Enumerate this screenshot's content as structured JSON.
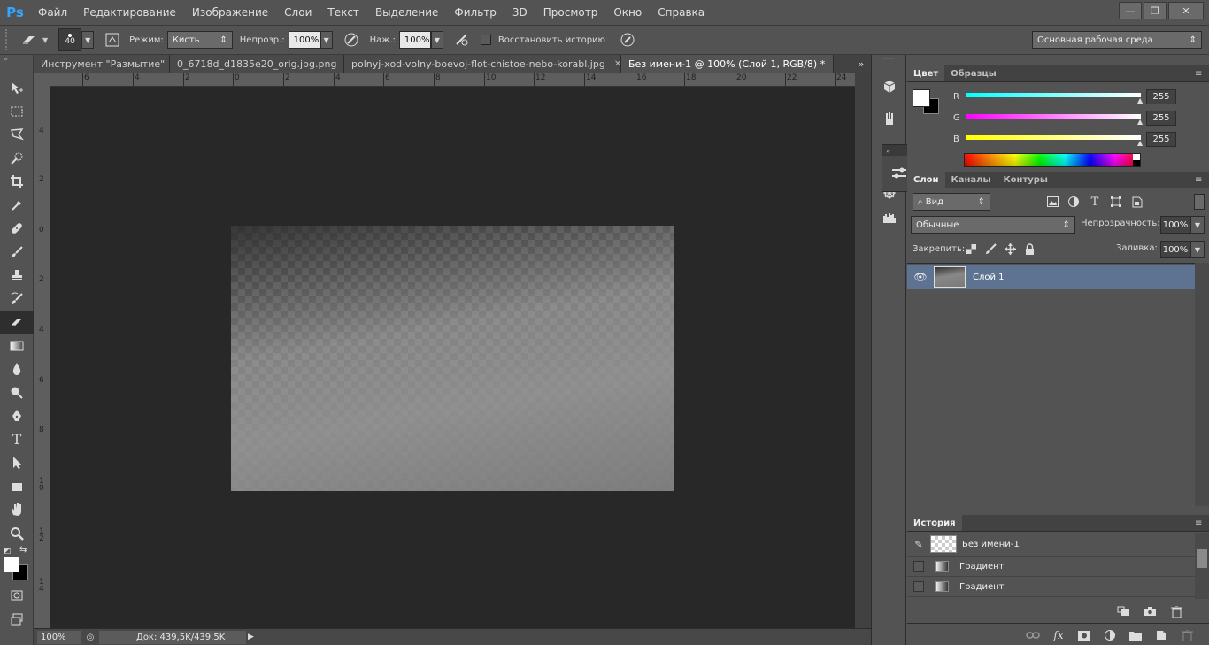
{
  "app": {
    "logo": "Ps"
  },
  "menu": [
    "Файл",
    "Редактирование",
    "Изображение",
    "Слои",
    "Текст",
    "Выделение",
    "Фильтр",
    "3D",
    "Просмотр",
    "Окно",
    "Справка"
  ],
  "window_controls": {
    "minimize": "—",
    "restore": "❐",
    "close": "✕"
  },
  "options": {
    "brush_size": "40",
    "mode_label": "Режим:",
    "mode_value": "Кисть",
    "opacity_label": "Непрозр.:",
    "opacity_value": "100%",
    "flow_label": "Наж.:",
    "flow_value": "100%",
    "restore_history_label": "Восстановить историю",
    "workspace_value": "Основная рабочая среда"
  },
  "tabs": [
    {
      "label": "Инструмент \"Размытие\"",
      "active": false
    },
    {
      "label": "0_6718d_d1835e20_orig.jpg.png",
      "active": false
    },
    {
      "label": "polnyj-xod-volny-boevoj-flot-chistoe-nebo-korabl.jpg",
      "active": false
    },
    {
      "label": "Без имени-1 @ 100% (Слой 1, RGB/8) *",
      "active": true
    }
  ],
  "tab_close": "✕",
  "tabs_more": "»",
  "rulers": {
    "h_ticks": [
      "6",
      "4",
      "2",
      "0",
      "2",
      "4",
      "6",
      "8",
      "10",
      "12",
      "14",
      "16",
      "18",
      "20",
      "22",
      "24"
    ],
    "v_ticks": [
      "4",
      "2",
      "0",
      "2",
      "4",
      "6",
      "8",
      "1\n0",
      "1\n2",
      "1\n4"
    ]
  },
  "status": {
    "zoom": "100%",
    "doc": "Док: 439,5K/439,5K"
  },
  "color_panel": {
    "tabs": [
      "Цвет",
      "Образцы"
    ],
    "channels": [
      {
        "label": "R",
        "value": "255",
        "color": "#00ffff"
      },
      {
        "label": "G",
        "value": "255",
        "color": "#ff00ff"
      },
      {
        "label": "B",
        "value": "255",
        "color": "#ffff00"
      }
    ]
  },
  "layers_panel": {
    "tabs": [
      "Слои",
      "Каналы",
      "Контуры"
    ],
    "filter_value": "Вид",
    "blend_mode": "Обычные",
    "opacity_label": "Непрозрачность:",
    "opacity_value": "100%",
    "lock_label": "Закрепить:",
    "fill_label": "Заливка:",
    "fill_value": "100%",
    "layers": [
      {
        "name": "Слой 1",
        "selected": true
      }
    ]
  },
  "history_panel": {
    "tab": "История",
    "snapshot": "Без имени-1",
    "steps": [
      "Градиент",
      "Градиент"
    ]
  },
  "colors": {
    "accent_selection": "#5d7391",
    "workspace_bg": "#282828",
    "ps_blue": "#31a8ff"
  }
}
